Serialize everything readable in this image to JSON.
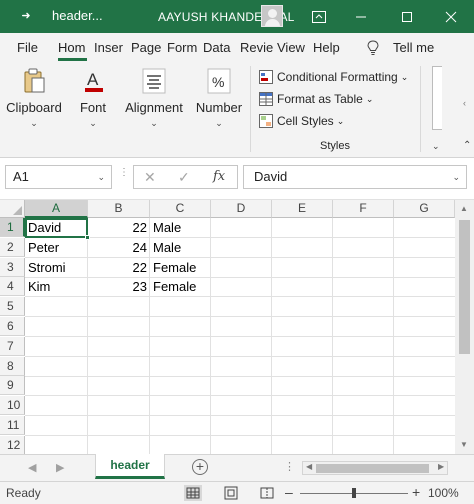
{
  "titlebar": {
    "doc_name": "header...",
    "user_name": "AAYUSH KHANDELWAL"
  },
  "tabs": [
    "File",
    "Hom",
    "Inser",
    "Page",
    "Form",
    "Data",
    "Revie",
    "View",
    "Help"
  ],
  "tell_me": "Tell me",
  "ribbon": {
    "clipboard": "Clipboard",
    "font": "Font",
    "alignment": "Alignment",
    "number": "Number",
    "conditional_formatting": "Conditional Formatting",
    "format_as_table": "Format as Table",
    "cell_styles": "Cell Styles",
    "styles_group": "Styles"
  },
  "formula_bar": {
    "name_box": "A1",
    "content": "David",
    "fx": "fx"
  },
  "columns": [
    "A",
    "B",
    "C",
    "D",
    "E",
    "F",
    "G"
  ],
  "rows": [
    "1",
    "2",
    "3",
    "4",
    "5",
    "6",
    "7",
    "8",
    "9",
    "10",
    "11",
    "12"
  ],
  "cells": [
    {
      "name": "David",
      "age": "22",
      "gender": "Male"
    },
    {
      "name": "Peter",
      "age": "24",
      "gender": "Male"
    },
    {
      "name": "Stromi",
      "age": "22",
      "gender": "Female"
    },
    {
      "name": "Kim",
      "age": "23",
      "gender": "Female"
    }
  ],
  "sheet_tab": "header",
  "status": {
    "ready": "Ready",
    "zoom": "100%"
  },
  "colors": {
    "accent": "#217346"
  }
}
